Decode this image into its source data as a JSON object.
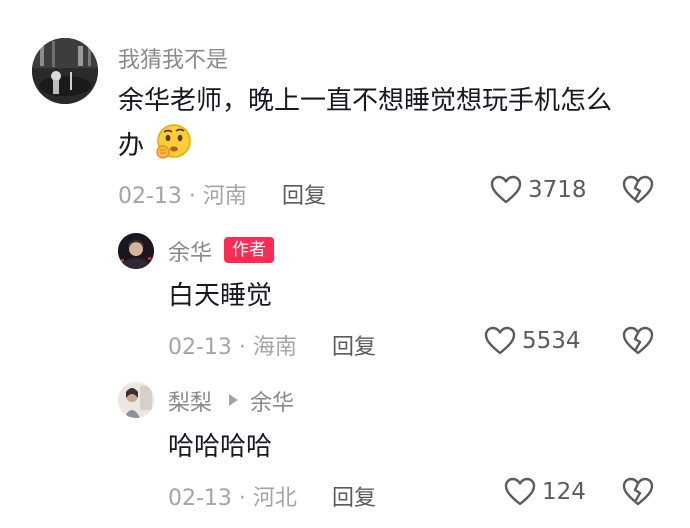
{
  "comments": [
    {
      "username": "我猜我不是",
      "text_line1": "余华老师，晚上一直不想睡觉想玩手机怎么",
      "text_line2": "办",
      "emoji": "thinking-face-emoji",
      "date": "02-13",
      "location": "河南",
      "separator": " · ",
      "reply_label": "回复",
      "likes": "3718"
    },
    {
      "username": "余华",
      "badge": "作者",
      "text": "白天睡觉",
      "date": "02-13",
      "location": "海南",
      "separator": " · ",
      "reply_label": "回复",
      "likes": "5534"
    },
    {
      "username": "梨梨",
      "reply_to": "余华",
      "text": "哈哈哈哈",
      "date": "02-13",
      "location": "河北",
      "separator": " · ",
      "reply_label": "回复",
      "likes": "124"
    }
  ],
  "colors": {
    "badge": "#fe2c55",
    "username": "#8a8a8e",
    "text": "#161823",
    "meta": "#a3a3a8"
  }
}
